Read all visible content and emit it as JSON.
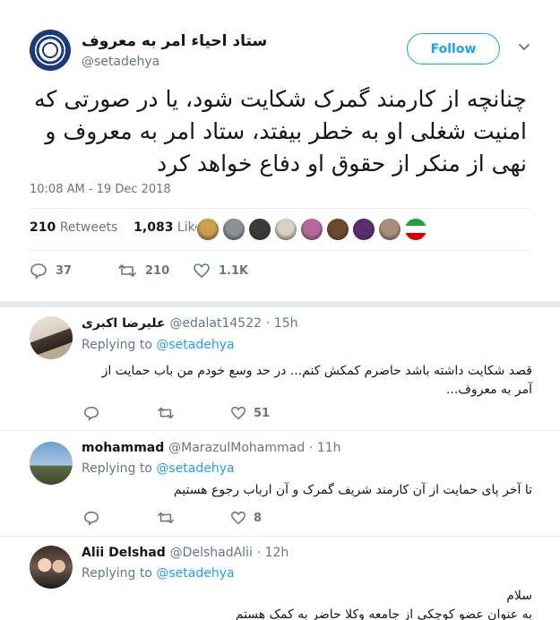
{
  "tweet": {
    "author_name": "ستاد احیاء امر به معروف",
    "author_handle": "@setadehya",
    "follow_label": "Follow",
    "text": "چنانچه از کارمند گمرک شکایت شود، یا در صورتی که امنیت شغلی او به خطر بیفتد، ستاد امر به معروف و نهی از منکر از حقوق او دفاع خواهد کرد",
    "timestamp": "10:08 AM - 19 Dec 2018",
    "retweets_count": "210",
    "retweets_label": "Retweets",
    "likes_count": "1,083",
    "likes_label": "Likes",
    "actions": {
      "replies": "37",
      "retweets": "210",
      "likes": "1.1K"
    },
    "likers_colors": [
      "#c9a04a",
      "#8a8f99",
      "#3a3a3a",
      "#d6d1c4",
      "#b56a9a",
      "#6b4a2f",
      "#5b2d6e",
      "#a88f7a",
      "#e8e8e8"
    ]
  },
  "replies": [
    {
      "name": "علیرضا اکبری",
      "handle": "@edalat14522",
      "time": "· 15h",
      "replying_prefix": "Replying to",
      "replying_to": "@setadehya",
      "text": "قصد شکایت داشته باشد حاضرم کمکش کنم... در حد وسع خودم من باب حمایت از آمر به معروف...",
      "likes": "51",
      "avatar_color": "#d8cfc2"
    },
    {
      "name": "mohammad",
      "handle": "@MarazulMohammad",
      "time": "· 11h",
      "replying_prefix": "Replying to",
      "replying_to": "@setadehya",
      "text": "تا آخر پای حمایت از آن کارمند شریف گمرک و آن ارباب رجوع هستیم",
      "likes": "8",
      "avatar_color": "#8fb4d6"
    },
    {
      "name": "Alii Delshad",
      "handle": "@DelshadAlii",
      "time": "· 12h",
      "replying_prefix": "Replying to",
      "replying_to": "@setadehya",
      "text_line1": "سلام",
      "text_line2": "به عنوان عضو کوچکی از جامعه وکلا حاضر به کمک هستم",
      "avatar_color": "#6e5a4e"
    }
  ]
}
